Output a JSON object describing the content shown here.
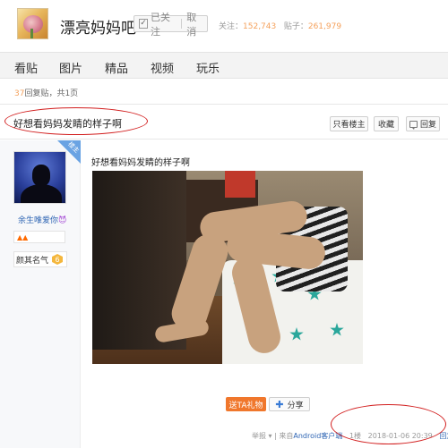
{
  "header": {
    "bar_name": "漂亮妈妈吧",
    "follow_status": "已关注",
    "cancel_label": "取 消",
    "followers_label": "关注：",
    "followers_count": "152,743",
    "posts_label": "贴子：",
    "posts_count": "261,979"
  },
  "nav": {
    "items": [
      "看贴",
      "图片",
      "精品",
      "视频",
      "玩乐"
    ]
  },
  "thread": {
    "reply_count": "37",
    "reply_text": "回复贴，共1页",
    "title": "好想看妈妈发睛的样子啊",
    "only_lz_label": "只看楼主",
    "collect_label": "收藏",
    "reply_label": "回复"
  },
  "post": {
    "lz_badge": "楼主",
    "username": "余生唯爱你",
    "user_emoji": "😈",
    "level_title": "颜其名气",
    "level_num": "6",
    "content": "好想看妈妈发睛的样子啊",
    "gift_label": "送TA礼物",
    "share_label": "分享",
    "report_label": "举报",
    "source_prefix": "| 来自",
    "source_link": "Android客户端",
    "floor": "1楼",
    "datetime": "2018-01-06 20:39",
    "reply_link": "回复"
  },
  "colors": {
    "accent_orange": "#f0772c",
    "link_blue": "#2d64b3",
    "annotation_red": "#d21e1e"
  }
}
